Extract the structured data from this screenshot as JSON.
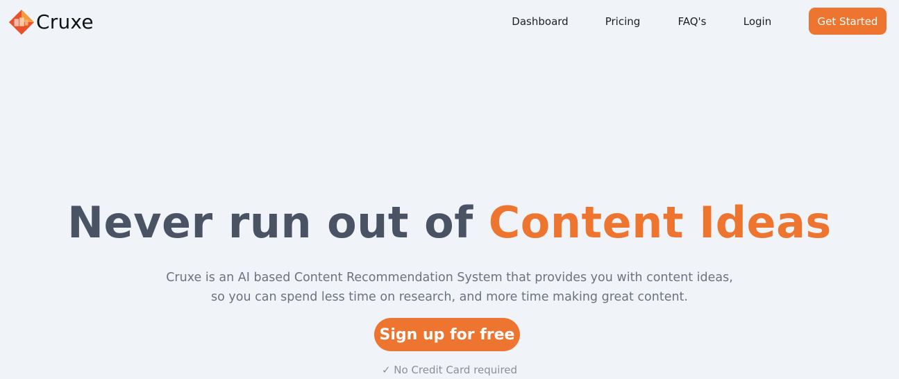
{
  "brand": {
    "name": "Cruxe",
    "logo_icon": "cruxe-logo-icon",
    "logo_colors": [
      "#e8512a",
      "#f39c3d",
      "#f2c6c0"
    ]
  },
  "nav": {
    "items": [
      {
        "label": "Dashboard"
      },
      {
        "label": "Pricing"
      },
      {
        "label": "FAQ's"
      },
      {
        "label": "Login"
      }
    ],
    "cta_label": "Get Started"
  },
  "hero": {
    "headline_plain": "Never run out of ",
    "headline_accent": "Content Ideas",
    "subtitle_line1": "Cruxe is an AI based Content Recommendation System that provides you with content ideas,",
    "subtitle_line2": "so you can spend less time on research, and more time making great content.",
    "signup_label": "Sign up for free",
    "note": "✓ No Credit Card required"
  },
  "colors": {
    "accent": "#ee7530",
    "heading": "#4a5363",
    "body_text": "#6b7280",
    "background": "#f0f3f8"
  }
}
